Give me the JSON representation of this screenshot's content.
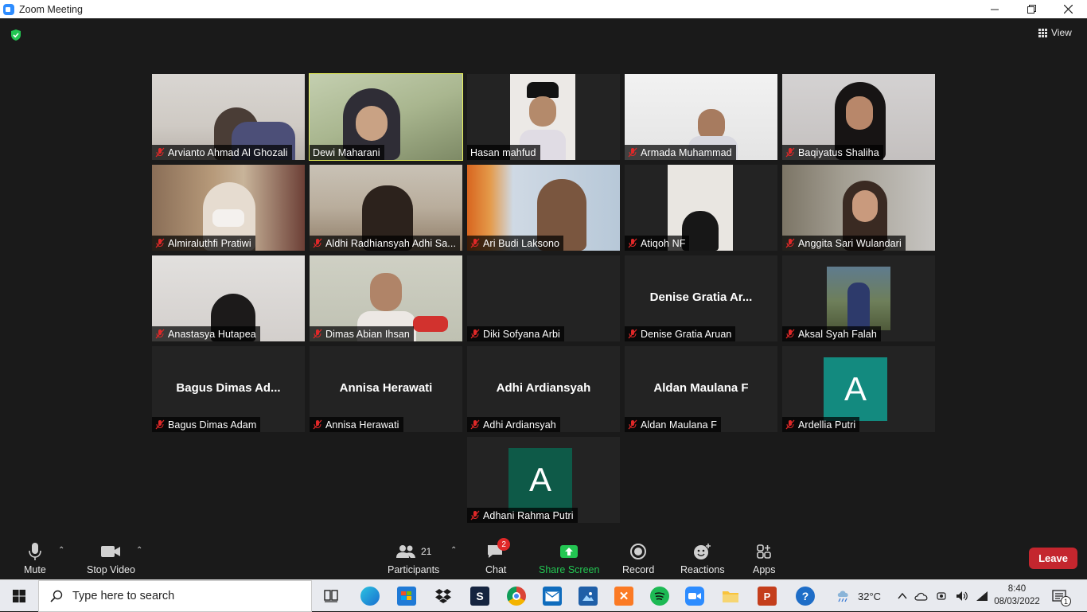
{
  "window": {
    "title": "Zoom Meeting",
    "controls": [
      "minimize",
      "restore",
      "close"
    ]
  },
  "header": {
    "view_label": "View",
    "security_icon": "shield-check-icon"
  },
  "participants": [
    {
      "name": "Arvianto Ahmad Al Ghozali",
      "muted": true,
      "type": "video"
    },
    {
      "name": "Dewi Maharani",
      "muted": false,
      "type": "video",
      "active_speaker": true
    },
    {
      "name": "Hasan mahfud",
      "muted": false,
      "type": "video"
    },
    {
      "name": "Armada Muhammad",
      "muted": true,
      "type": "video"
    },
    {
      "name": "Baqiyatus Shaliha",
      "muted": true,
      "type": "video"
    },
    {
      "name": "Almiraluthfi Pratiwi",
      "muted": true,
      "type": "video"
    },
    {
      "name": "Aldhi Radhiansyah Adhi Sa...",
      "muted": true,
      "type": "video"
    },
    {
      "name": "Ari Budi Laksono",
      "muted": true,
      "type": "video"
    },
    {
      "name": "Atiqoh NF",
      "muted": true,
      "type": "video"
    },
    {
      "name": "Anggita Sari Wulandari",
      "muted": true,
      "type": "video"
    },
    {
      "name": "Anastasya Hutapea",
      "muted": true,
      "type": "video"
    },
    {
      "name": "Dimas Abian Ihsan",
      "muted": true,
      "type": "video"
    },
    {
      "name": "Diki Sofyana Arbi",
      "muted": true,
      "type": "empty"
    },
    {
      "name": "Denise Gratia Aruan",
      "display": "Denise Gratia Ar...",
      "muted": true,
      "type": "name"
    },
    {
      "name": "Aksal Syah Falah",
      "muted": true,
      "type": "photo"
    },
    {
      "name": "Bagus Dimas Adam",
      "display": "Bagus Dimas Ad...",
      "muted": true,
      "type": "name"
    },
    {
      "name": "Annisa Herawati",
      "display": "Annisa Herawati",
      "muted": true,
      "type": "name"
    },
    {
      "name": "Adhi Ardiansyah",
      "display": "Adhi Ardiansyah",
      "muted": true,
      "type": "name"
    },
    {
      "name": "Aldan Maulana F",
      "display": "Aldan Maulana F",
      "muted": true,
      "type": "name"
    },
    {
      "name": "Ardellia Putri",
      "avatar_letter": "A",
      "muted": true,
      "type": "avatar",
      "avatar_color": "#138a7f"
    },
    {
      "name": "Adhani Rahma Putri",
      "avatar_letter": "A",
      "muted": true,
      "type": "avatar",
      "avatar_color": "#0e5a48"
    }
  ],
  "toolbar": {
    "mute_label": "Mute",
    "stop_video_label": "Stop Video",
    "participants_label": "Participants",
    "participants_count": "21",
    "chat_label": "Chat",
    "chat_badge": "2",
    "share_screen_label": "Share Screen",
    "record_label": "Record",
    "reactions_label": "Reactions",
    "apps_label": "Apps",
    "leave_label": "Leave"
  },
  "colors": {
    "active_speaker_border": "#e7f05a",
    "share_green": "#23c552",
    "leave_red": "#c4262e",
    "muted_red": "#e02828"
  },
  "taskbar": {
    "search_placeholder": "Type here to search",
    "apps": [
      "task-view-icon",
      "edge-icon",
      "store-icon",
      "dropbox-icon",
      "sublime-icon",
      "chrome-icon",
      "mail-icon",
      "photos-icon",
      "xampp-icon",
      "spotify-icon",
      "zoom-icon",
      "file-explorer-icon",
      "powerpoint-icon",
      "help-icon"
    ],
    "weather": "32°C",
    "time": "8:40",
    "date": "08/03/2022",
    "notification_count": "1"
  }
}
